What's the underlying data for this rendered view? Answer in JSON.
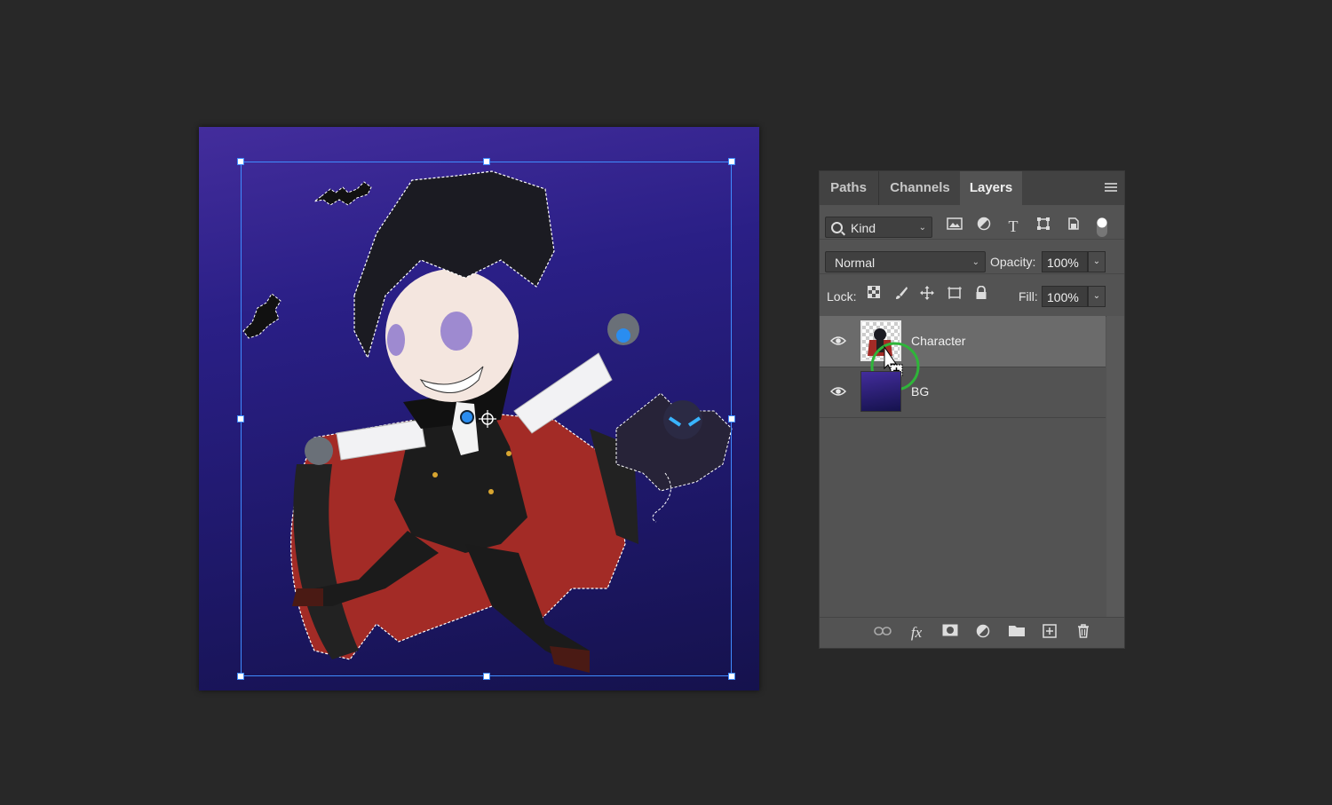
{
  "layers_panel": {
    "tabs": [
      {
        "label": "Paths"
      },
      {
        "label": "Channels"
      },
      {
        "label": "Layers",
        "active": true
      }
    ],
    "filter": {
      "label": "Kind",
      "icons": [
        "image-filter-icon",
        "adjustment-filter-icon",
        "type-filter-icon",
        "shape-filter-icon",
        "smart-object-filter-icon",
        "filter-toggle-icon"
      ]
    },
    "blend_mode": "Normal",
    "opacity_label": "Opacity:",
    "opacity_value": "100%",
    "lock_label": "Lock:",
    "fill_label": "Fill:",
    "fill_value": "100%",
    "layers": [
      {
        "name": "Character",
        "visible": true,
        "selected": true
      },
      {
        "name": "BG",
        "visible": true,
        "selected": false
      }
    ],
    "bottom_icons": [
      "link-layers-icon",
      "fx-icon",
      "add-mask-icon",
      "adjustment-layer-icon",
      "new-group-icon",
      "new-layer-icon",
      "delete-layer-icon"
    ],
    "bottom_fx_label": "fx"
  },
  "canvas": {
    "background_colors": [
      "#432d9c",
      "#15124d"
    ],
    "selection_color": "#3f8cff"
  }
}
